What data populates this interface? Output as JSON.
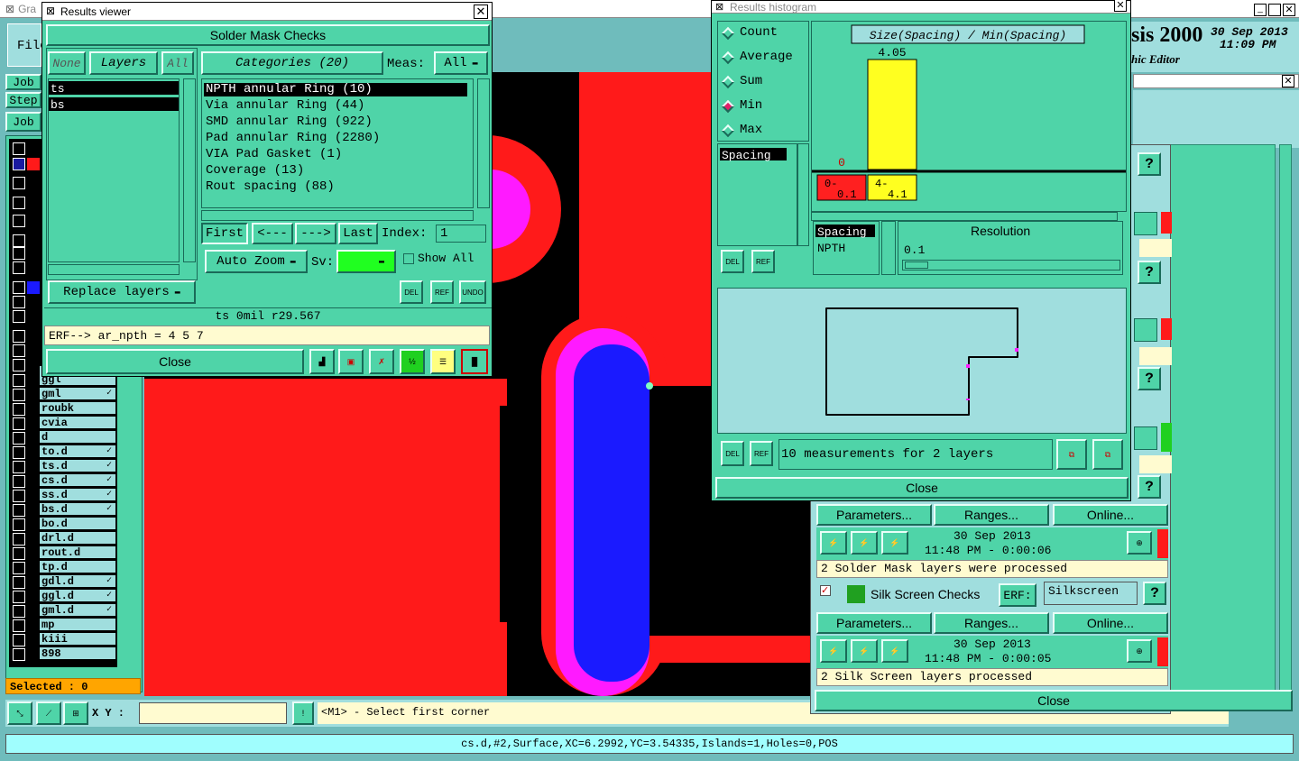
{
  "main_window": {
    "title_left": "Gra",
    "menu_file": "File",
    "left_buttons": [
      "Job",
      "Step",
      "Job"
    ],
    "brand": "sis 2000",
    "brand_sub": "hic Editor",
    "date": "30  Sep 2013",
    "time": "11:09 PM",
    "layers": [
      {
        "name": "ggl",
        "mark": ""
      },
      {
        "name": "gml",
        "mark": "✓"
      },
      {
        "name": "roubk",
        "mark": ""
      },
      {
        "name": "cvia",
        "mark": ""
      },
      {
        "name": "d",
        "mark": ""
      },
      {
        "name": "to.d",
        "mark": "✓"
      },
      {
        "name": "ts.d",
        "mark": "✓"
      },
      {
        "name": "cs.d",
        "mark": "✓"
      },
      {
        "name": "ss.d",
        "mark": "✓"
      },
      {
        "name": "bs.d",
        "mark": "✓"
      },
      {
        "name": "bo.d",
        "mark": ""
      },
      {
        "name": "drl.d",
        "mark": ""
      },
      {
        "name": "rout.d",
        "mark": ""
      },
      {
        "name": "tp.d",
        "mark": ""
      },
      {
        "name": "gdl.d",
        "mark": "✓"
      },
      {
        "name": "ggl.d",
        "mark": "✓"
      },
      {
        "name": "gml.d",
        "mark": "✓"
      },
      {
        "name": "mp",
        "mark": ""
      },
      {
        "name": "kiii",
        "mark": ""
      },
      {
        "name": "898",
        "mark": ""
      }
    ],
    "selected": "Selected : 0",
    "xy_label": "X Y :",
    "xy_value": "",
    "prompt": "<M1> - Select first corner",
    "status_bar": "cs.d,#2,Surface,XC=6.2992,YC=3.54335,Islands=1,Holes=0,POS"
  },
  "results_viewer": {
    "title": "Results viewer",
    "check_title": "Solder Mask Checks",
    "none_btn": "None",
    "layers_btn": "Layers",
    "all_btn": "All",
    "layer_items": [
      "ts",
      "bs"
    ],
    "categories_btn": "Categories (20)",
    "meas_label": "Meas:",
    "meas_value": "All",
    "categories": [
      "NPTH annular Ring (10)",
      "Via annular Ring (44)",
      "SMD annular Ring (922)",
      "Pad annular Ring (2280)",
      "VIA Pad Gasket (1)",
      "Coverage (13)",
      "Rout spacing (88)"
    ],
    "first_btn": "First",
    "prev_btn": "<---",
    "next_btn": "--->",
    "last_btn": "Last",
    "index_label": "Index:",
    "index_value": "1",
    "auto_zoom": "Auto Zoom",
    "sv_label": "Sv:",
    "show_all": "Show All",
    "replace_layers": "Replace layers",
    "del": "DEL",
    "ref": "REF",
    "undo": "UNDO",
    "info_line": "ts 0mil  r29.567",
    "erf_line": "ERF--> ar_npth = 4 5 7",
    "close": "Close"
  },
  "histogram": {
    "title": "Results histogram",
    "options": [
      "Count",
      "Average",
      "Sum",
      "Min",
      "Max"
    ],
    "selected_option": "Min",
    "list_item": "Spacing",
    "chart_title": "Size(Spacing) / Min(Spacing)",
    "spacing_list": [
      "Spacing",
      "NPTH"
    ],
    "resolution_label": "Resolution",
    "resolution_value": "0.1",
    "del": "DEL",
    "ref": "REF",
    "measurements": "10 measurements for 2 layers",
    "close": "Close"
  },
  "chart_data": {
    "type": "bar",
    "title": "Size(Spacing) / Min(Spacing)",
    "categories": [
      "0-0.1",
      "4-4.1"
    ],
    "values": [
      0,
      4.05
    ],
    "data_labels": [
      "0",
      "4.05"
    ],
    "bin_labels": [
      [
        "0-",
        "0.1"
      ],
      [
        "4-",
        "4.1"
      ]
    ],
    "colors": [
      "#ff2020",
      "#ffff20"
    ],
    "ylim": [
      0,
      4.05
    ]
  },
  "checks_panel": {
    "parameters": "Parameters...",
    "ranges": "Ranges...",
    "online": "Online...",
    "run1_date": "30 Sep 2013",
    "run1_time": "11:48 PM - 0:00:06",
    "run1_msg": "2 Solder Mask layers were processed",
    "silk_title": "Silk Screen Checks",
    "erf_label": "ERF:",
    "erf_value": "Silkscreen",
    "run2_date": "30 Sep 2013",
    "run2_time": "11:48 PM - 0:00:05",
    "run2_msg": "2 Silk Screen layers processed",
    "close": "Close",
    "help": "?"
  },
  "colors": {
    "teal": "#4fd4a8",
    "cyan": "#a0dede",
    "red": "#ff1a1a",
    "magenta": "#ff1aff",
    "blue": "#1a1aff"
  }
}
